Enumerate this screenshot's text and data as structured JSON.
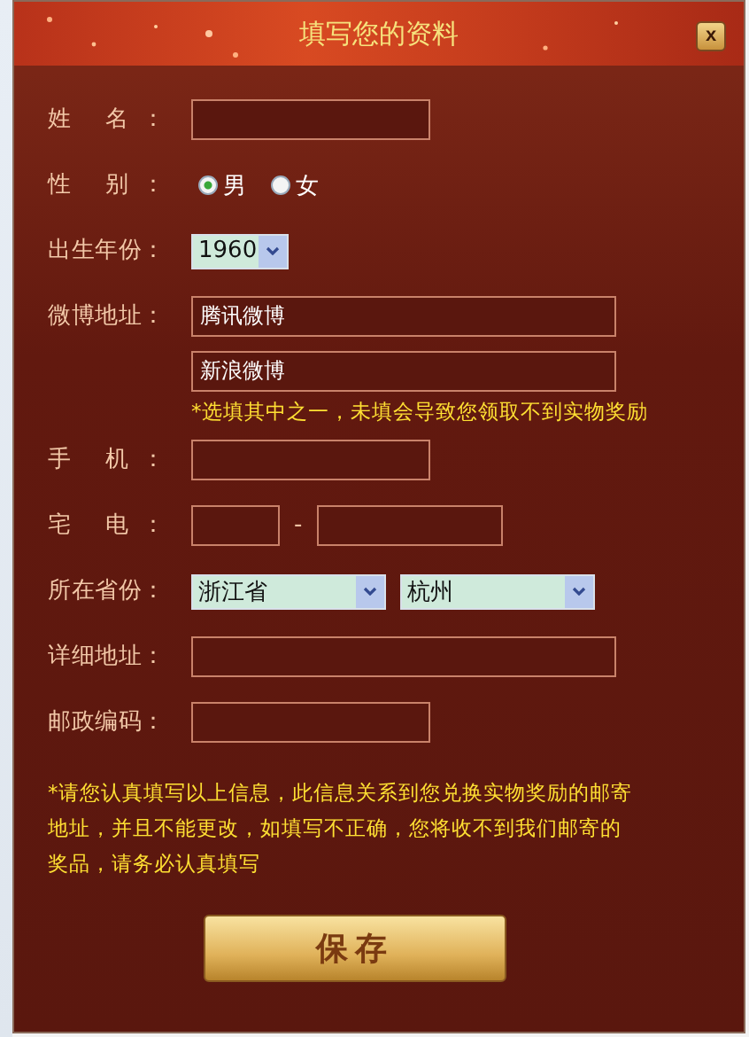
{
  "dialog": {
    "title": "填写您的资料",
    "close": "x"
  },
  "rows": [
    {
      "kind": "text-short",
      "label": "姓 名："
    },
    {
      "kind": "radio",
      "label": "性 别：",
      "options": [
        {
          "label": "男",
          "selected": true
        },
        {
          "label": "女",
          "selected": false
        }
      ]
    },
    {
      "kind": "select-small",
      "label": "出生年份：",
      "value": "1960"
    },
    {
      "kind": "multi-text",
      "label": "微博地址：",
      "values": [
        "腾讯微博",
        "新浪微博"
      ],
      "note": "*选填其中之一，未填会导致您领取不到实物奖励"
    },
    {
      "kind": "text-short",
      "label": "手 机："
    },
    {
      "kind": "phone",
      "label": "宅 电：",
      "separator": "-"
    },
    {
      "kind": "selects",
      "label": "所在省份：",
      "values": [
        "浙江省",
        "杭州"
      ]
    },
    {
      "kind": "text-long",
      "label": "详细地址："
    },
    {
      "kind": "text-short",
      "label": "邮政编码："
    }
  ],
  "notice": "*请您认真填写以上信息，此信息关系到您兑换实物奖励的邮寄地址，并且不能更改，如填写不正确，您将收不到我们邮寄的奖品，请务必认真填写",
  "save_button": "保存"
}
